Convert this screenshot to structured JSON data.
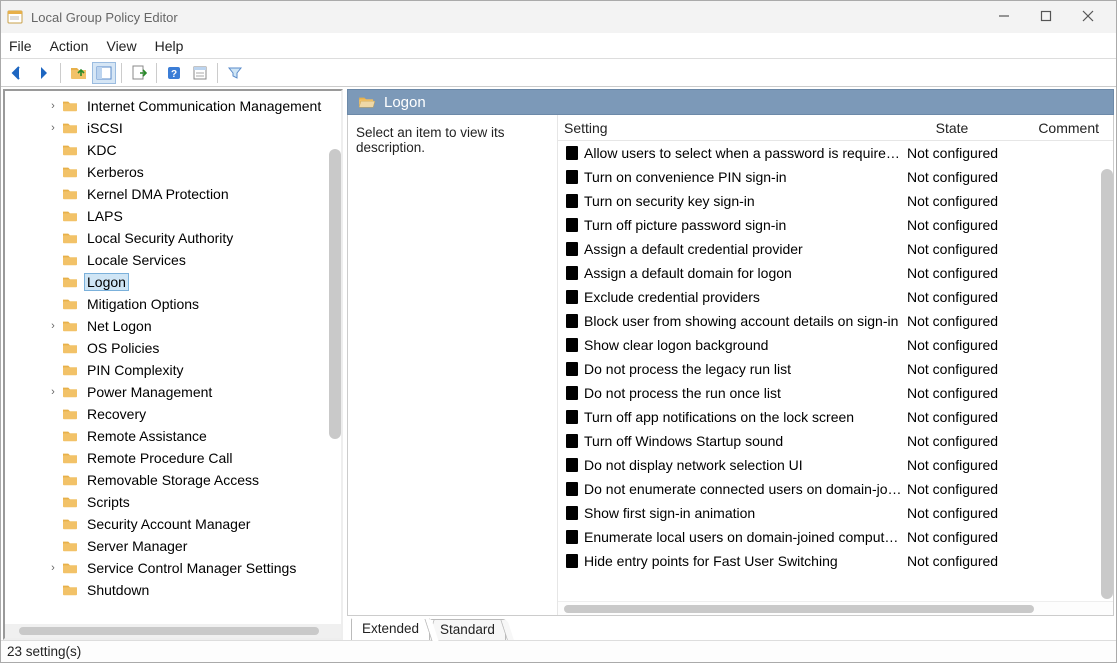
{
  "window": {
    "title": "Local Group Policy Editor"
  },
  "menu": {
    "file": "File",
    "action": "Action",
    "view": "View",
    "help": "Help"
  },
  "tree": {
    "items": [
      {
        "label": "Internet Communication Management",
        "expandable": true
      },
      {
        "label": "iSCSI",
        "expandable": true
      },
      {
        "label": "KDC"
      },
      {
        "label": "Kerberos"
      },
      {
        "label": "Kernel DMA Protection"
      },
      {
        "label": "LAPS"
      },
      {
        "label": "Local Security Authority"
      },
      {
        "label": "Locale Services"
      },
      {
        "label": "Logon",
        "selected": true
      },
      {
        "label": "Mitigation Options"
      },
      {
        "label": "Net Logon",
        "expandable": true
      },
      {
        "label": "OS Policies"
      },
      {
        "label": "PIN Complexity"
      },
      {
        "label": "Power Management",
        "expandable": true
      },
      {
        "label": "Recovery"
      },
      {
        "label": "Remote Assistance"
      },
      {
        "label": "Remote Procedure Call"
      },
      {
        "label": "Removable Storage Access"
      },
      {
        "label": "Scripts"
      },
      {
        "label": "Security Account Manager"
      },
      {
        "label": "Server Manager"
      },
      {
        "label": "Service Control Manager Settings",
        "expandable": true
      },
      {
        "label": "Shutdown"
      }
    ]
  },
  "details": {
    "crumb": "Logon",
    "description": "Select an item to view its description.",
    "columns": {
      "setting": "Setting",
      "state": "State",
      "comment": "Comment"
    },
    "settings": [
      {
        "name": "Allow users to select when a password is required when resuming from connected standby",
        "state": "Not configured"
      },
      {
        "name": "Turn on convenience PIN sign-in",
        "state": "Not configured"
      },
      {
        "name": "Turn on security key sign-in",
        "state": "Not configured"
      },
      {
        "name": "Turn off picture password sign-in",
        "state": "Not configured"
      },
      {
        "name": "Assign a default credential provider",
        "state": "Not configured"
      },
      {
        "name": "Assign a default domain for logon",
        "state": "Not configured"
      },
      {
        "name": "Exclude credential providers",
        "state": "Not configured"
      },
      {
        "name": "Block user from showing account details on sign-in",
        "state": "Not configured"
      },
      {
        "name": "Show clear logon background",
        "state": "Not configured"
      },
      {
        "name": "Do not process the legacy run list",
        "state": "Not configured"
      },
      {
        "name": "Do not process the run once list",
        "state": "Not configured"
      },
      {
        "name": "Turn off app notifications on the lock screen",
        "state": "Not configured"
      },
      {
        "name": "Turn off Windows Startup sound",
        "state": "Not configured"
      },
      {
        "name": "Do not display network selection UI",
        "state": "Not configured"
      },
      {
        "name": "Do not enumerate connected users on domain-joined computers",
        "state": "Not configured"
      },
      {
        "name": "Show first sign-in animation",
        "state": "Not configured"
      },
      {
        "name": "Enumerate local users on domain-joined computers",
        "state": "Not configured"
      },
      {
        "name": "Hide entry points for Fast User Switching",
        "state": "Not configured"
      }
    ],
    "tabs": {
      "extended": "Extended",
      "standard": "Standard"
    }
  },
  "status": {
    "text": "23 setting(s)"
  }
}
